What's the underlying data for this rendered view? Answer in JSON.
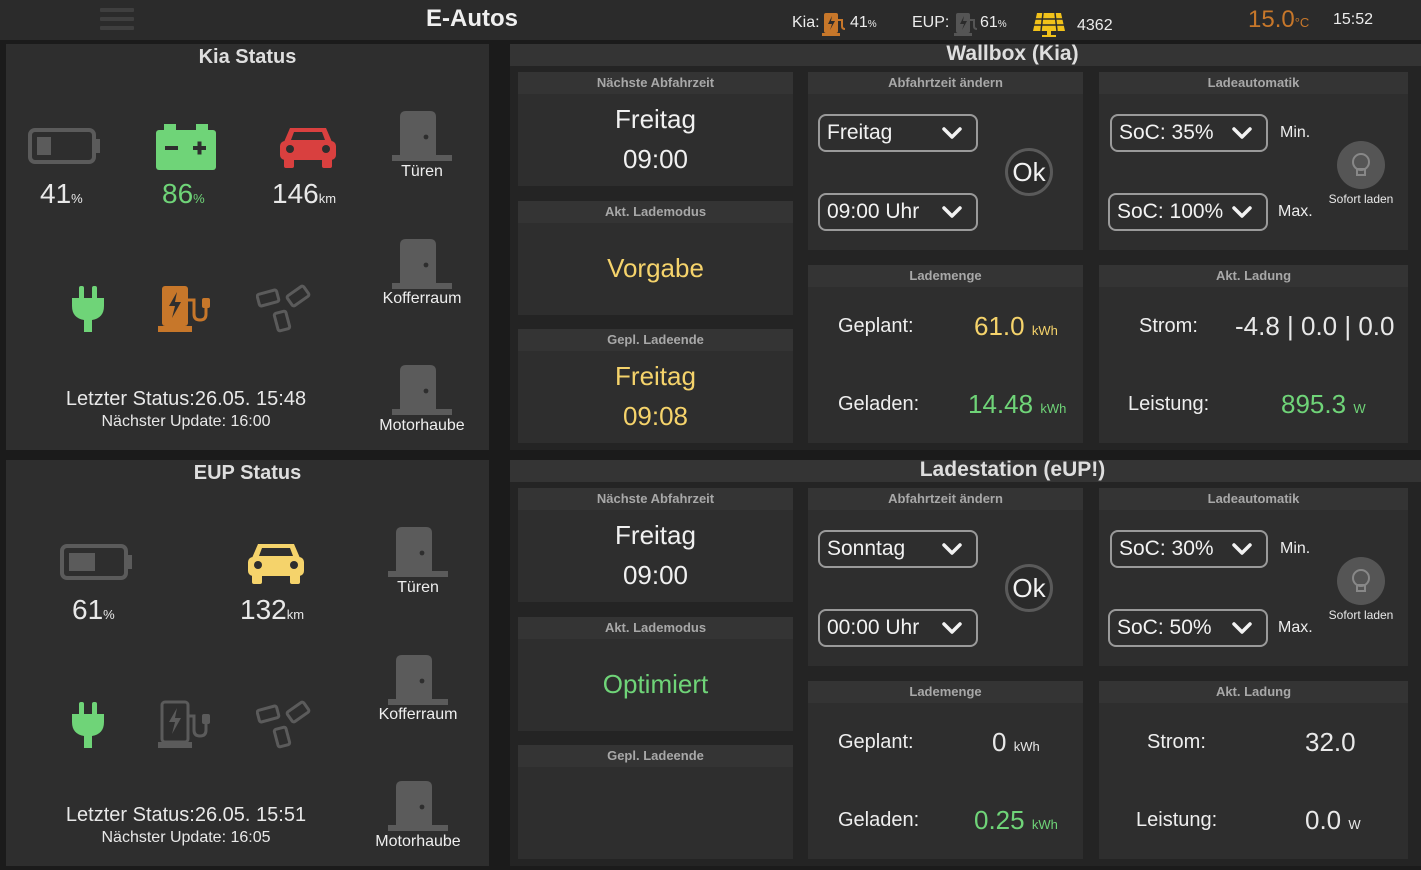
{
  "header": {
    "title": "E-Autos",
    "kia_label": "Kia:",
    "kia_soc": "41",
    "kia_unit": "%",
    "eup_label": "EUP:",
    "eup_soc": "61",
    "eup_unit": "%",
    "solar_value": "4362",
    "temperature": "15.0",
    "temp_unit": "°C",
    "time": "15:52"
  },
  "kia_status": {
    "title": "Kia Status",
    "battery_12v_soc": "41",
    "hv_battery_soc": "86",
    "range": "146",
    "percent_unit": "%",
    "km_unit": "km",
    "doors_label": "Türen",
    "trunk_label": "Kofferraum",
    "hood_label": "Motorhaube",
    "last_status": "Letzter Status:26.05. 15:48",
    "next_update": "Nächster Update: 16:00"
  },
  "eup_status": {
    "title": "EUP Status",
    "battery_soc": "61",
    "range": "132",
    "percent_unit": "%",
    "km_unit": "km",
    "doors_label": "Türen",
    "trunk_label": "Kofferraum",
    "hood_label": "Motorhaube",
    "last_status": "Letzter Status:26.05. 15:51",
    "next_update": "Nächster Update: 16:05"
  },
  "wallbox": {
    "title": "Wallbox (Kia)",
    "next_departure": {
      "head": "Nächste Abfahrzeit",
      "day": "Freitag",
      "time": "09:00"
    },
    "charge_mode": {
      "head": "Akt. Lademodus",
      "value": "Vorgabe"
    },
    "planned_end": {
      "head": "Gepl. Ladeende",
      "day": "Freitag",
      "time": "09:08"
    },
    "change_departure": {
      "head": "Abfahrtzeit ändern",
      "day": "Freitag",
      "time": "09:00 Uhr",
      "ok": "Ok"
    },
    "auto_charge": {
      "head": "Ladeautomatik",
      "min": "SoC: 35%",
      "min_label": "Min.",
      "max": "SoC: 100%",
      "max_label": "Max.",
      "instant": "Sofort laden"
    },
    "charge_amount": {
      "head": "Lademenge",
      "planned_label": "Geplant:",
      "planned": "61.0",
      "charged_label": "Geladen:",
      "charged": "14.48",
      "unit": "kWh"
    },
    "current_charge": {
      "head": "Akt. Ladung",
      "current_label": "Strom:",
      "current": "-4.8 | 0.0 | 0.0",
      "power_label": "Leistung:",
      "power": "895.3",
      "power_unit": "W"
    }
  },
  "station": {
    "title": "Ladestation (eUP!)",
    "next_departure": {
      "head": "Nächste Abfahrzeit",
      "day": "Freitag",
      "time": "09:00"
    },
    "charge_mode": {
      "head": "Akt. Lademodus",
      "value": "Optimiert"
    },
    "planned_end": {
      "head": "Gepl. Ladeende",
      "day": "",
      "time": ""
    },
    "change_departure": {
      "head": "Abfahrtzeit ändern",
      "day": "Sonntag",
      "time": "00:00 Uhr",
      "ok": "Ok"
    },
    "auto_charge": {
      "head": "Ladeautomatik",
      "min": "SoC: 30%",
      "min_label": "Min.",
      "max": "SoC: 50%",
      "max_label": "Max.",
      "instant": "Sofort laden"
    },
    "charge_amount": {
      "head": "Lademenge",
      "planned_label": "Geplant:",
      "planned": "0",
      "charged_label": "Geladen:",
      "charged": "0.25",
      "unit": "kWh"
    },
    "current_charge": {
      "head": "Akt. Ladung",
      "current_label": "Strom:",
      "current": "32.0",
      "power_label": "Leistung:",
      "power": "0.0",
      "power_unit": "W"
    }
  },
  "colors": {
    "green": "#6fd478",
    "yellow": "#f5d36b",
    "red": "#d9403f",
    "orange": "#c7772a",
    "grey_icon": "#5b5b5b"
  }
}
